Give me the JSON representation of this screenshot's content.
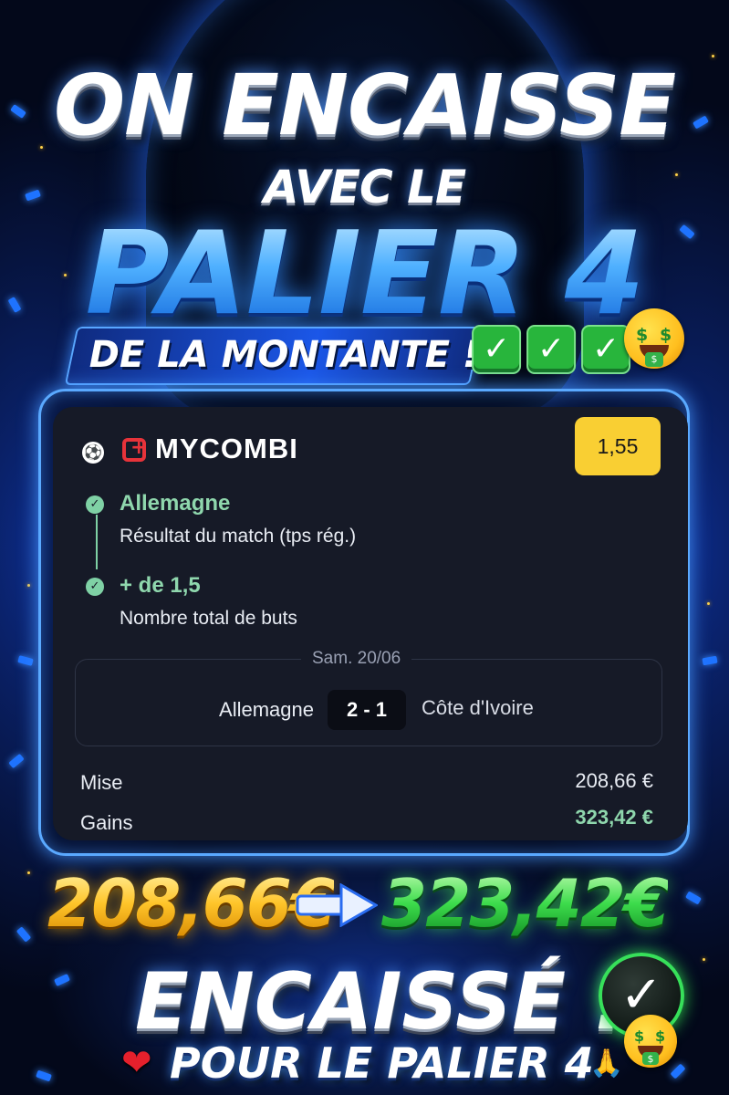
{
  "headline": {
    "line1": "ON ENCAISSE",
    "line2": "AVEC LE",
    "line3": "PALIER 4",
    "banner": "DE LA MONTANTE !!",
    "checks": [
      "✓",
      "✓",
      "✓"
    ],
    "emoji": "money-mouth-face"
  },
  "bet_card": {
    "brand": "MYCOMBI",
    "odds": "1,55",
    "selections": [
      {
        "pick": "Allemagne",
        "market": "Résultat du match (tps rég.)",
        "status": "won"
      },
      {
        "pick": "+ de 1,5",
        "market": "Nombre total de buts",
        "status": "won"
      }
    ],
    "match": {
      "date": "Sam. 20/06",
      "home": "Allemagne",
      "score": "2 - 1",
      "away": "Côte d'Ivoire"
    },
    "stake_label": "Mise",
    "stake_value": "208,66 €",
    "winnings_label": "Gains",
    "winnings_value": "323,42 €"
  },
  "summary": {
    "from_amount": "208,66€",
    "to_amount": "323,42€",
    "status": "ENCAISSÉ !",
    "footer": "POUR LE PALIER 4"
  },
  "colors": {
    "accent_blue": "#1e73ff",
    "win_green": "#8fd7ad",
    "odds_yellow": "#f9cf33",
    "brand_red": "#e7333a"
  }
}
